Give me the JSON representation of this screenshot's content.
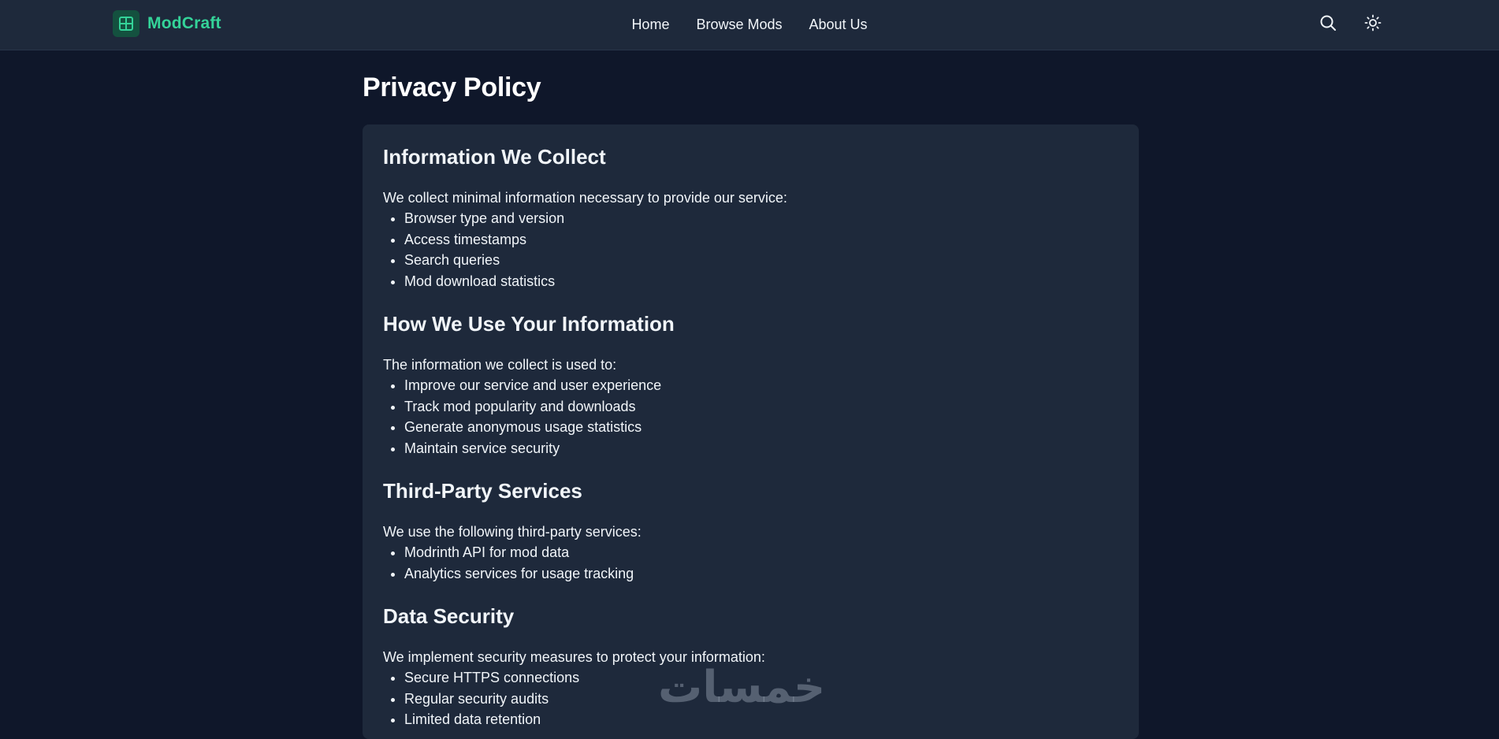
{
  "header": {
    "brand": "ModCraft",
    "nav": [
      {
        "label": "Home"
      },
      {
        "label": "Browse Mods"
      },
      {
        "label": "About Us"
      }
    ],
    "icons": {
      "logo": "grid-icon",
      "search": "search-icon",
      "theme": "sun-icon"
    }
  },
  "page": {
    "title": "Privacy Policy"
  },
  "sections": [
    {
      "heading": "Information We Collect",
      "intro": "We collect minimal information necessary to provide our service:",
      "items": [
        "Browser type and version",
        "Access timestamps",
        "Search queries",
        "Mod download statistics"
      ]
    },
    {
      "heading": "How We Use Your Information",
      "intro": "The information we collect is used to:",
      "items": [
        "Improve our service and user experience",
        "Track mod popularity and downloads",
        "Generate anonymous usage statistics",
        "Maintain service security"
      ]
    },
    {
      "heading": "Third-Party Services",
      "intro": "We use the following third-party services:",
      "items": [
        "Modrinth API for mod data",
        "Analytics services for usage tracking"
      ]
    },
    {
      "heading": "Data Security",
      "intro": "We implement security measures to protect your information:",
      "items": [
        "Secure HTTPS connections",
        "Regular security audits",
        "Limited data retention"
      ]
    }
  ],
  "watermark": "خمسات",
  "colors": {
    "background": "#0f172a",
    "surface": "#1e293b",
    "accent": "#34d399"
  }
}
